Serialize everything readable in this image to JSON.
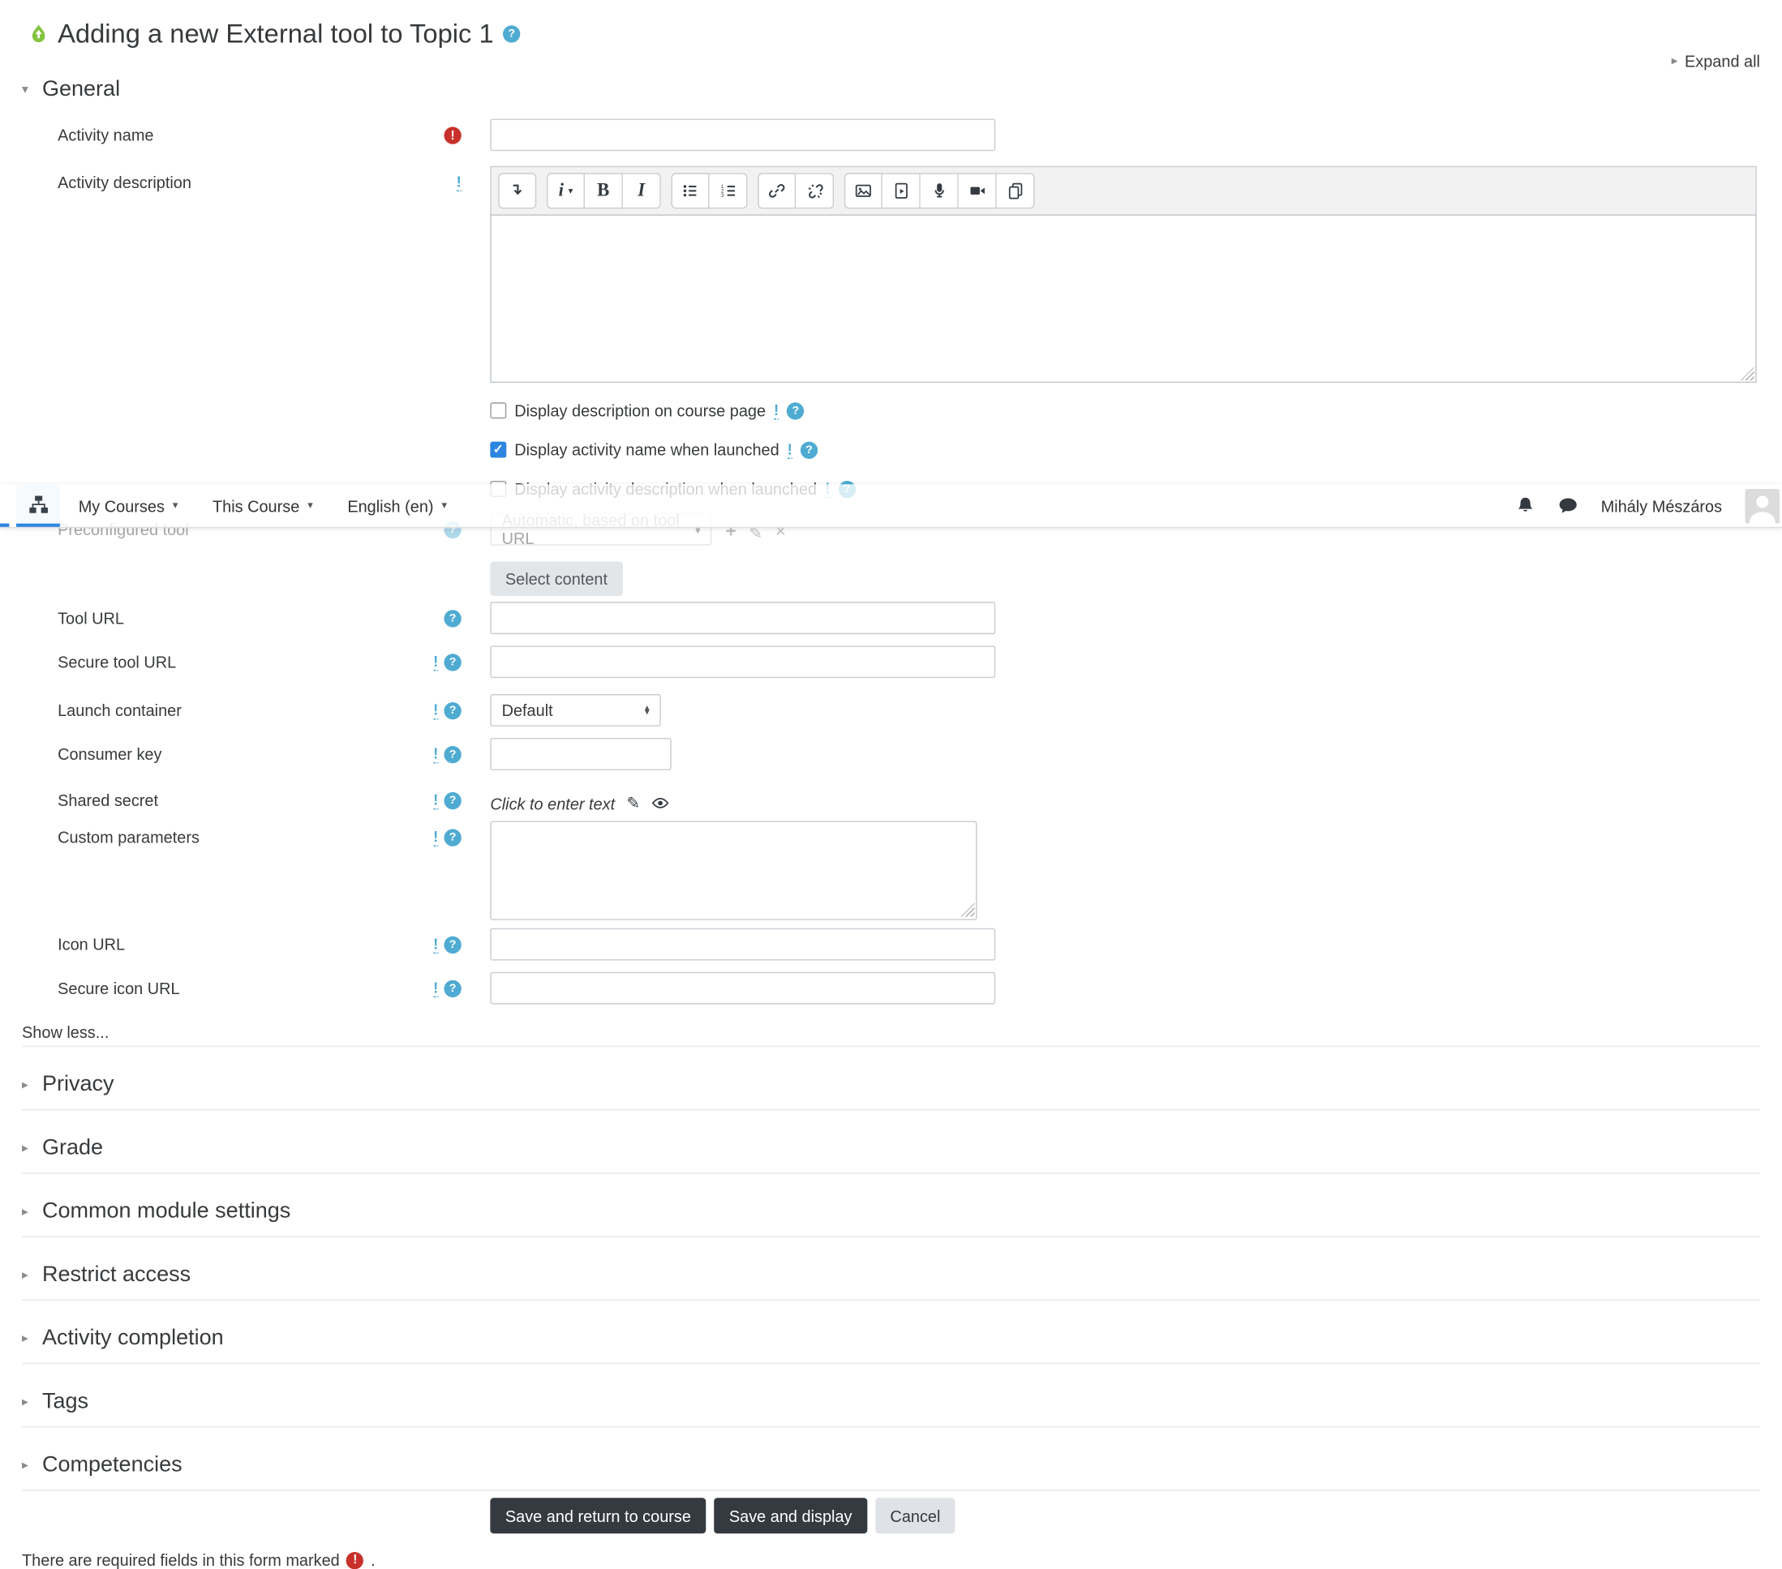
{
  "header": {
    "title": "Adding a new External tool to Topic 1",
    "expand_all": "Expand all"
  },
  "navbar": {
    "menus": [
      "My Courses",
      "This Course",
      "English (en)"
    ],
    "user_name": "Mihály Mészáros"
  },
  "general": {
    "heading": "General",
    "rows": {
      "activity_name": {
        "label": "Activity name",
        "value": ""
      },
      "activity_description": {
        "label": "Activity description",
        "value": ""
      },
      "preconfigured_tool": {
        "label": "Preconfigured tool",
        "value": "Automatic, based on tool URL"
      },
      "tool_url": {
        "label": "Tool URL",
        "value": ""
      },
      "secure_tool_url": {
        "label": "Secure tool URL",
        "value": ""
      },
      "launch_container": {
        "label": "Launch container",
        "value": "Default"
      },
      "consumer_key": {
        "label": "Consumer key",
        "value": ""
      },
      "shared_secret": {
        "label": "Shared secret",
        "placeholder": "Click to enter text"
      },
      "custom_parameters": {
        "label": "Custom parameters",
        "value": ""
      },
      "icon_url": {
        "label": "Icon URL",
        "value": ""
      },
      "secure_icon_url": {
        "label": "Secure icon URL",
        "value": ""
      }
    },
    "checkboxes": [
      {
        "label": "Display description on course page",
        "checked": false
      },
      {
        "label": "Display activity name when launched",
        "checked": true
      },
      {
        "label": "Display activity description when launched",
        "checked": false
      }
    ],
    "select_content_button": "Select content",
    "show_less": "Show less..."
  },
  "collapsed_sections": [
    "Privacy",
    "Grade",
    "Common module settings",
    "Restrict access",
    "Activity completion",
    "Tags",
    "Competencies"
  ],
  "actions": {
    "save_and_return": "Save and return to course",
    "save_and_display": "Save and display",
    "cancel": "Cancel"
  },
  "footer": {
    "required_note": "There are required fields in this form marked",
    "note_suffix": "."
  },
  "editor_toolbar_icons": [
    "collapse-toolbar",
    "paragraph-styles",
    "bold",
    "italic",
    "unordered-list",
    "ordered-list",
    "link",
    "unlink",
    "insert-image",
    "insert-media",
    "record-audio",
    "record-video",
    "manage-files"
  ],
  "icons": {
    "caret_down": "▾",
    "triangle_right": "▸",
    "triangle_down": "▾",
    "help": "?",
    "required": "!",
    "info": "!",
    "pencil": "✎",
    "plus": "+",
    "edit": "✎",
    "delete": "×",
    "check": "✓",
    "stepper_up": "▴",
    "stepper_down": "▾",
    "styles_glyph": "i",
    "bold_glyph": "B",
    "italic_glyph": "I"
  },
  "colors": {
    "primary_blue": "#2c86e0",
    "help_icon_blue": "#4fabd2",
    "required_red": "#c8312b",
    "tool_icon_green": "#84c33f",
    "button_dark": "#343a40"
  }
}
